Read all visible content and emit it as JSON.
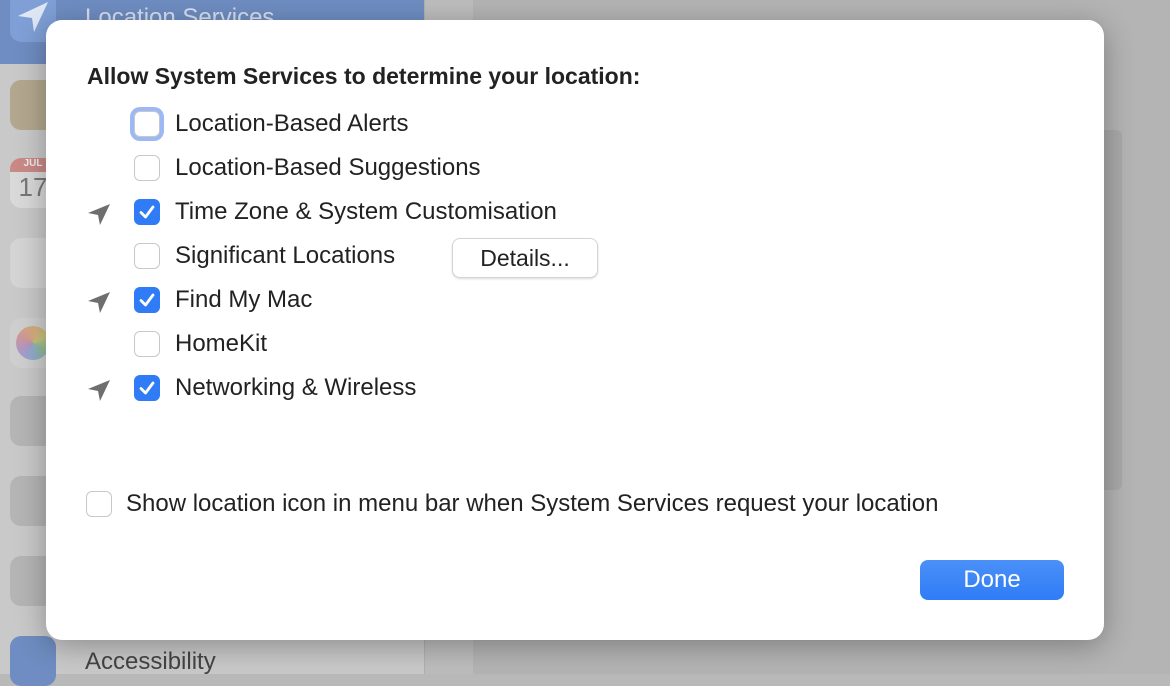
{
  "background": {
    "sidebar": {
      "selected_item": "Location Services",
      "bottom_item": "Accessibility",
      "calendar_icon": {
        "month": "JUL",
        "day": "17"
      }
    }
  },
  "dialog": {
    "title": "Allow System Services to determine your location:",
    "services": [
      {
        "label": "Location-Based Alerts",
        "checked": false,
        "location_icon": false,
        "focused": true
      },
      {
        "label": "Location-Based Suggestions",
        "checked": false,
        "location_icon": false
      },
      {
        "label": "Time Zone & System Customisation",
        "checked": true,
        "location_icon": true
      },
      {
        "label": "Significant Locations",
        "checked": false,
        "location_icon": false
      },
      {
        "label": "Find My Mac",
        "checked": true,
        "location_icon": true
      },
      {
        "label": "HomeKit",
        "checked": false,
        "location_icon": false
      },
      {
        "label": "Networking & Wireless",
        "checked": true,
        "location_icon": true
      }
    ],
    "details_button": "Details...",
    "menu_bar_option": {
      "label": "Show location icon in menu bar when System Services request your location",
      "checked": false
    },
    "done_button": "Done",
    "accent_color": "#2f7cf6"
  }
}
